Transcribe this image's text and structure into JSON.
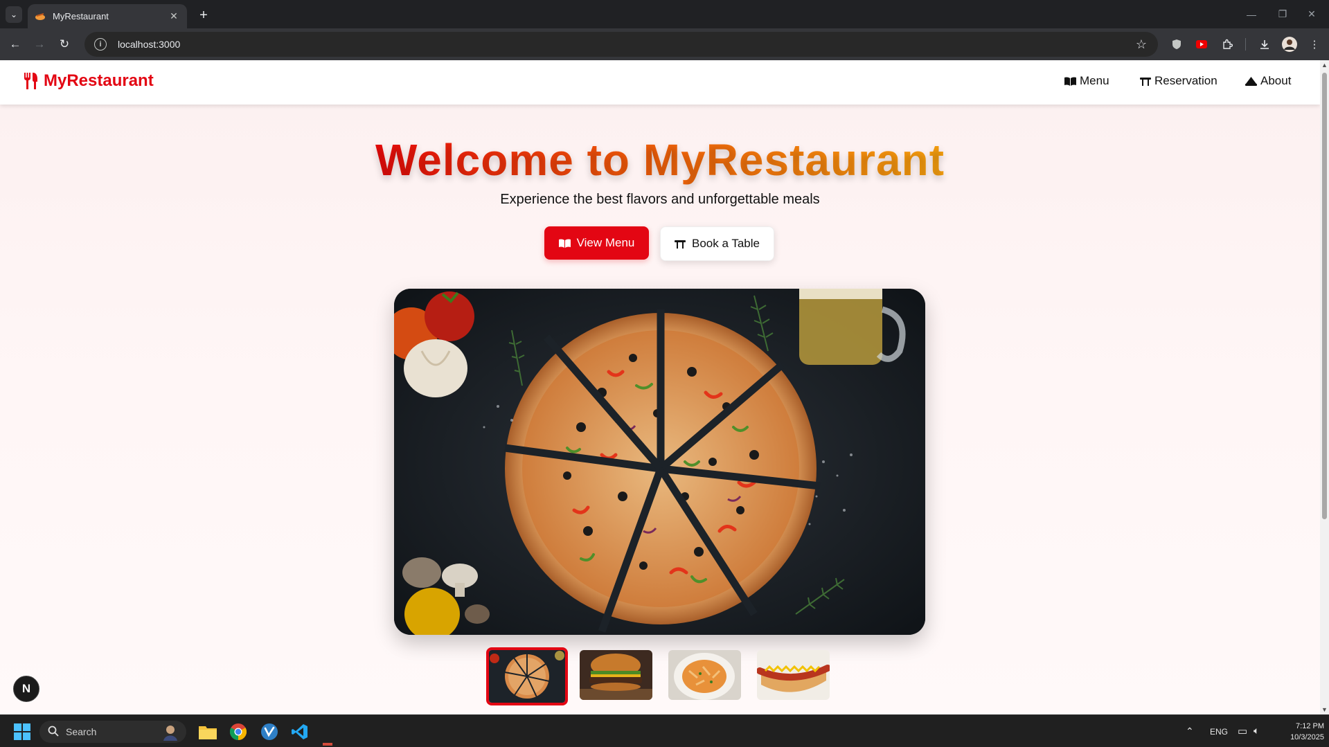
{
  "browser": {
    "tab_title": "MyRestaurant",
    "url": "localhost:3000"
  },
  "site": {
    "brand": "MyRestaurant",
    "nav": [
      {
        "label": "Menu",
        "icon": "book-open-icon"
      },
      {
        "label": "Reservation",
        "icon": "table-icon"
      },
      {
        "label": "About",
        "icon": "chef-hat-icon"
      }
    ]
  },
  "hero": {
    "title": "Welcome to MyRestaurant",
    "subtitle": "Experience the best flavors and unforgettable meals",
    "primary_button": "View Menu",
    "secondary_button": "Book a Table"
  },
  "carousel": {
    "active_index": 0,
    "items": [
      "pizza",
      "burger",
      "pasta",
      "hotdog"
    ]
  },
  "taskbar": {
    "search_placeholder": "Search",
    "language": "ENG",
    "time": "7:12 PM",
    "date": "10/3/2025"
  },
  "colors": {
    "brand_red": "#e30613",
    "gradient_start": "#e80a0a",
    "gradient_end": "#f6a00f"
  }
}
